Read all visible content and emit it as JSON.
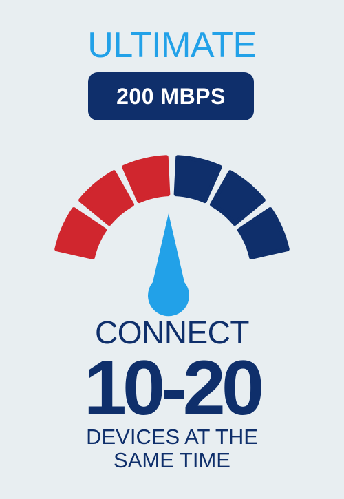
{
  "plan": {
    "title": "ULTIMATE",
    "speed": "200 MBPS"
  },
  "gauge": {
    "segments": [
      {
        "color": "#d0262e"
      },
      {
        "color": "#d0262e"
      },
      {
        "color": "#d0262e"
      },
      {
        "color": "#0f2f6b"
      },
      {
        "color": "#0f2f6b"
      },
      {
        "color": "#0f2f6b"
      }
    ],
    "needle_color": "#22a1e8"
  },
  "devices": {
    "connect_label": "CONNECT",
    "range": "10-20",
    "caption_line1": "DEVICES AT THE",
    "caption_line2": "SAME TIME"
  },
  "colors": {
    "accent_blue": "#22a1e8",
    "navy": "#0f2f6b",
    "red": "#d0262e",
    "background": "#e8eef1"
  }
}
